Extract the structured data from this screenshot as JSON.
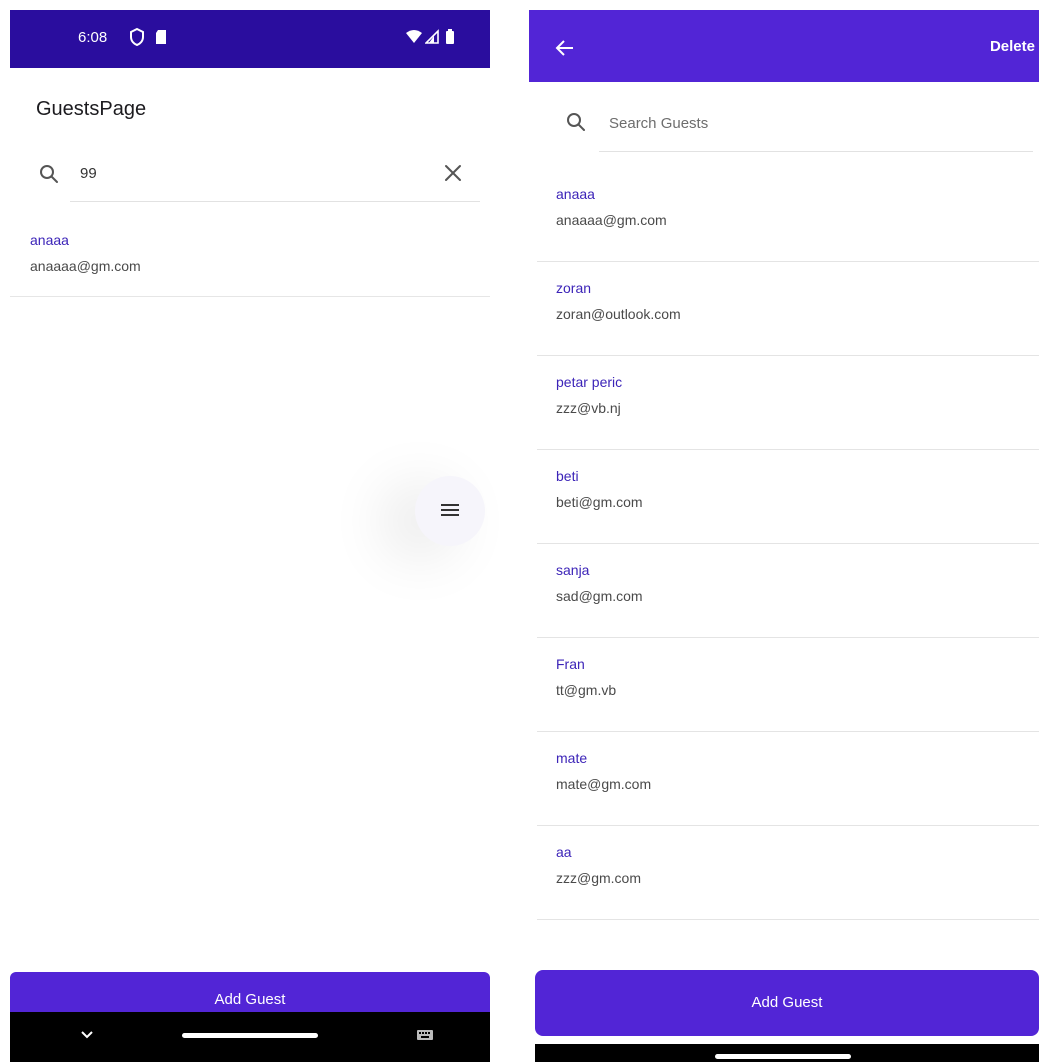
{
  "left_screen": {
    "status_bar": {
      "time": "6:08",
      "background": "#2a0d9e",
      "icons": [
        "shield-icon",
        "sim-card-icon",
        "wifi-icon",
        "cell-signal-icon",
        "battery-icon"
      ]
    },
    "page_title": "GuestsPage",
    "search": {
      "value": "99",
      "icon": "search-icon",
      "clear_icon": "close-icon"
    },
    "results": [
      {
        "name": "anaaa",
        "email": "anaaaa@gm.com"
      }
    ],
    "fab_icon": "menu-icon",
    "add_button_label": "Add Guest",
    "nav_bar": {
      "icons": [
        "chevron-down-icon",
        "home-pill",
        "keyboard-icon"
      ]
    }
  },
  "right_screen": {
    "app_bar": {
      "back_icon": "arrow-back-icon",
      "delete_label": "Delete",
      "background": "#5225d6"
    },
    "search": {
      "placeholder": "Search Guests",
      "icon": "search-icon"
    },
    "guests": [
      {
        "name": "anaaa",
        "email": "anaaaa@gm.com"
      },
      {
        "name": "zoran",
        "email": "zoran@outlook.com"
      },
      {
        "name": "petar peric",
        "email": "zzz@vb.nj"
      },
      {
        "name": "beti",
        "email": "beti@gm.com"
      },
      {
        "name": "sanja",
        "email": "sad@gm.com"
      },
      {
        "name": "Fran",
        "email": "tt@gm.vb"
      },
      {
        "name": "mate",
        "email": "mate@gm.com"
      },
      {
        "name": "aa",
        "email": "zzz@gm.com"
      }
    ],
    "add_button_label": "Add Guest"
  },
  "colors": {
    "accent": "#5225d6",
    "status_bar": "#2a0d9e",
    "guest_name": "#3c24b8",
    "guest_email": "#4a4a4a"
  }
}
